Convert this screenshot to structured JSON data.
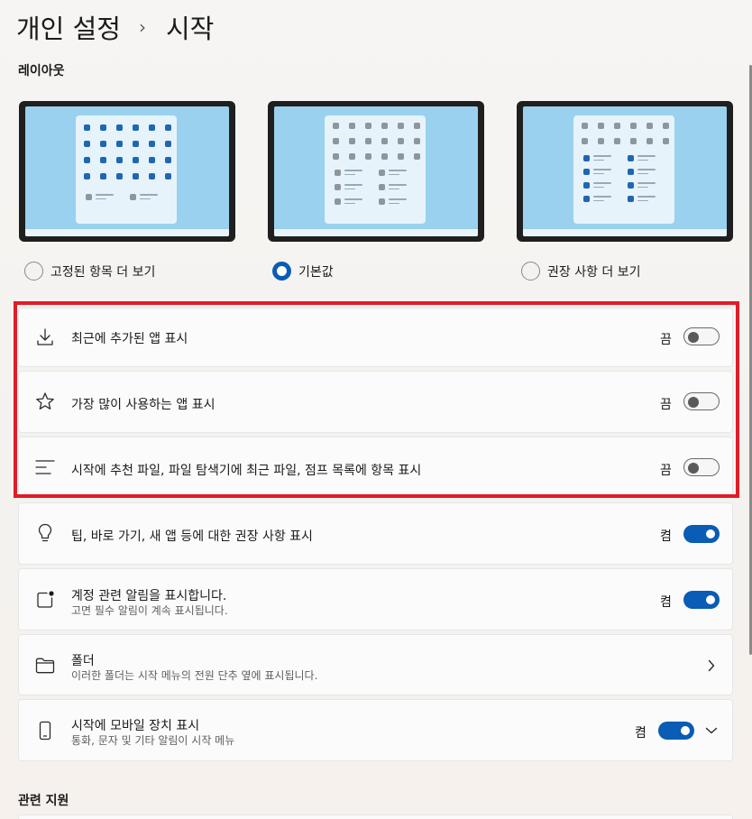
{
  "breadcrumb": {
    "parent": "개인 설정",
    "separator": "›",
    "current": "시작"
  },
  "layout": {
    "title": "레이아웃",
    "options": [
      {
        "label": "고정된 항목 더 보기",
        "selected": false
      },
      {
        "label": "기본값",
        "selected": true
      },
      {
        "label": "권장 사항 더 보기",
        "selected": false
      }
    ]
  },
  "settings": [
    {
      "icon": "download-icon",
      "label": "최근에 추가된 앱 표시",
      "state": "끔",
      "on": false
    },
    {
      "icon": "star-icon",
      "label": "가장 많이 사용하는 앱 표시",
      "state": "끔",
      "on": false
    },
    {
      "icon": "list-lines-icon",
      "label": "시작에 추천 파일, 파일 탐색기에 최근 파일, 점프 목록에 항목 표시",
      "state": "끔",
      "on": false
    },
    {
      "icon": "lightbulb-icon",
      "label": "팁, 바로 가기, 새 앱 등에 대한 권장 사항 표시",
      "state": "켬",
      "on": true
    },
    {
      "icon": "notification-badge-icon",
      "label": "계정 관련 알림을 표시합니다.",
      "sub": "고면 필수 알림이 계속 표시됩니다.",
      "state": "켬",
      "on": true
    },
    {
      "icon": "folder-icon",
      "label": "폴더",
      "sub": "이러한 폴더는 시작 메뉴의 전원 단추 옆에 표시됩니다."
    },
    {
      "icon": "mobile-phone-icon",
      "label": "시작에 모바일 장치 표시",
      "sub": "통화, 문자 및 기타 알림이 시작 메뉴",
      "state": "켬",
      "on": true
    }
  ],
  "related": {
    "title": "관련 지원"
  },
  "colors": {
    "accent": "#0a5cb4",
    "highlight": "#e21b25"
  }
}
